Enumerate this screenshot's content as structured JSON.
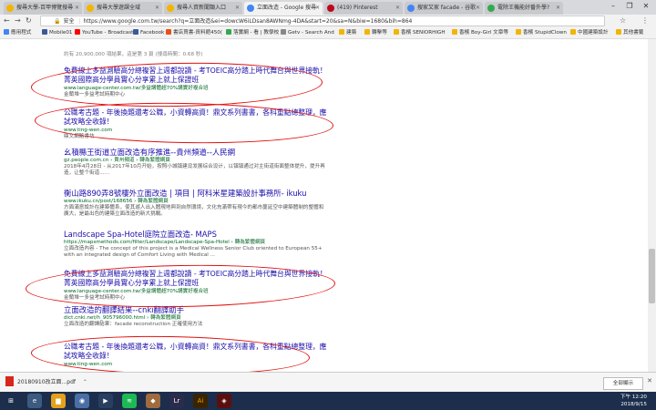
{
  "tabs": [
    {
      "label": "搜尋大學-百甲博覽搜尋",
      "color": "#f4b400"
    },
    {
      "label": "搜尋大學遊課全域",
      "color": "#f4b400"
    },
    {
      "label": "搜尋人資新聞類入口",
      "color": "#f4b400"
    },
    {
      "label": "立面改造 - Google 搜尋",
      "color": "#4285f4"
    },
    {
      "label": "(419) Pinterest",
      "color": "#bd081c"
    },
    {
      "label": "搜家又家 facade - 谷歌",
      "color": "#4285f4"
    },
    {
      "label": "電除王機能好番外學?",
      "color": "#34a853"
    }
  ],
  "omnibox": {
    "secure": "安全",
    "url": "https://www.google.com.tw/search?q=立面改造&ei=dowcW6iLDsan8AWNmg-4DA&start=20&sa=N&biw=1680&bih=864"
  },
  "bookmarks": [
    {
      "label": "應用程式",
      "color": "#4285f4"
    },
    {
      "label": "Mobile01",
      "color": "#3b5998"
    },
    {
      "label": "YouTube - Broadcast",
      "color": "#ff0000"
    },
    {
      "label": "Facebook",
      "color": "#3b5998"
    },
    {
      "label": "書店買書-資料館450(",
      "color": "#e94e1b"
    },
    {
      "label": "落實網 - 看 | 教學校",
      "color": "#34a853"
    },
    {
      "label": "Getv - Search And",
      "color": "#888888"
    },
    {
      "label": "建築",
      "color": "#f4b400"
    },
    {
      "label": "轉擊等",
      "color": "#f4b400"
    },
    {
      "label": "香檳 SENIORHIGH",
      "color": "#f4b400"
    },
    {
      "label": "香檳 Boy-Girl 文章等",
      "color": "#f4b400"
    },
    {
      "label": "香檳 StupidClown",
      "color": "#f4b400"
    },
    {
      "label": "中國建築設計",
      "color": "#f4b400"
    },
    {
      "label": "其他書籤",
      "color": "#f4b400"
    }
  ],
  "search": {
    "stats": "約有 20,900,000 項結果，這是第 3 頁 (搜尋時間：0.68 秒)"
  },
  "results": [
    {
      "title": "免費線上多益測驗高分總複習上週都說讀 - 考TOEIC高分踏上時代舞台與世界接軌！菁英國際高分學員實心分享累上就上保證班",
      "url": "www.language-center.com.tw/多益講體超70%講實好複合班",
      "snippet": "金蘭堆一多益考試時期中心"
    },
    {
      "title": "公職考古題 - 年後換題還考公職，小資轉高資！鼎文系列書書，各科重點總整理，應試攻略全收錄！",
      "url": "www.ting-wen.com",
      "snippet": "鼎文網路書坊"
    },
    {
      "title": "幺積縣王街道立面改造有序推進--貴州頻道--人民網",
      "url": "gz.people.com.cn › 貴州頻道 › 轉為繁體網頁",
      "snippet": "2018年4月28日 - 从2017年10月开始，按照小城镇建设发展综合设计，以镇镇通过对主街道街面整体提升，提升再造，让整个街道……"
    },
    {
      "title": "衡山路890弄8號樓外立面改造 | 項目 | 阿科米星建築設計事務所- ikuku",
      "url": "www.ikuku.cn/post/168656 › 轉為繁體網頁",
      "snippet": "方面滿意設計在建築體系，使其遊人出入體現地與到自然環境，文化充滿帶有現今的都市蔓延空中建築體制的整體和廣大，是最出色的建築立面改造的新大挑戰。"
    },
    {
      "title": "Landscape Spa-Hotel庭院立面改造- MAPS",
      "url": "https://mapsmethods.com/filter/Landscape/Landscape-Spa-Hotel › 轉為繁體網頁",
      "snippet": "立面改造內容 - The concept of this project is a Medical Wellness Senior Club oriented to European 55+ with an integrated design of Comfort Living with Medical ..."
    },
    {
      "title": "免費線上多益測驗高分總複習上週都說讀 - 考TOEIC高分踏上時代舞台與世界接軌！菁英國際高分學員實心分享累上就上保證班",
      "url": "www.language-center.com.tw/多益講體超70%講實好複合班",
      "snippet": "金蘭堆一多益考試時期中心"
    },
    {
      "title": "立面改造的翻譯結果--cnki翻譯助手",
      "url": "dict.cnki.net/h_905796000.html › 轉為繁體網頁",
      "snippet": "立面改造的翻譯結果：facade reconstruction 正確使用方法"
    },
    {
      "title": "公職考古題 - 年後換題還考公職，小資轉高資！鼎文系列書書，各科重點總整理，應試攻略全收錄！",
      "url": "www.ting-wen.com",
      "snippet": "鼎文網路書坊"
    }
  ],
  "download": {
    "file": "20180910改立面...pdf",
    "show_all": "全部顯示"
  },
  "taskbar": {
    "time": "下午 12:20",
    "date": "2018/9/15"
  }
}
